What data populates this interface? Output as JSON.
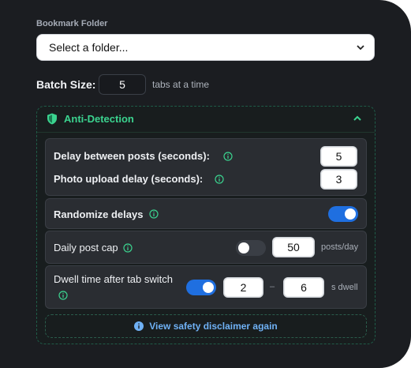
{
  "folder": {
    "label": "Bookmark Folder",
    "selected": "Select a folder..."
  },
  "batch": {
    "label": "Batch Size:",
    "value": "5",
    "suffix": "tabs at a time"
  },
  "anti_detection": {
    "title": "Anti-Detection",
    "delay_posts": {
      "label": "Delay between posts (seconds):",
      "value": "5"
    },
    "photo_delay": {
      "label": "Photo upload delay (seconds):",
      "value": "3"
    },
    "randomize": {
      "label": "Randomize delays",
      "enabled": true
    },
    "daily_cap": {
      "label": "Daily post cap",
      "enabled": false,
      "value": "50",
      "unit": "posts/day"
    },
    "dwell": {
      "label": "Dwell time after tab switch",
      "enabled": true,
      "min": "2",
      "dash": "–",
      "max": "6",
      "unit": "s dwell"
    },
    "disclaimer": "View safety disclaimer again"
  },
  "colors": {
    "accent_green": "#3bd38f",
    "toggle_on": "#1f6fe0",
    "link_blue": "#6fb1f5"
  }
}
